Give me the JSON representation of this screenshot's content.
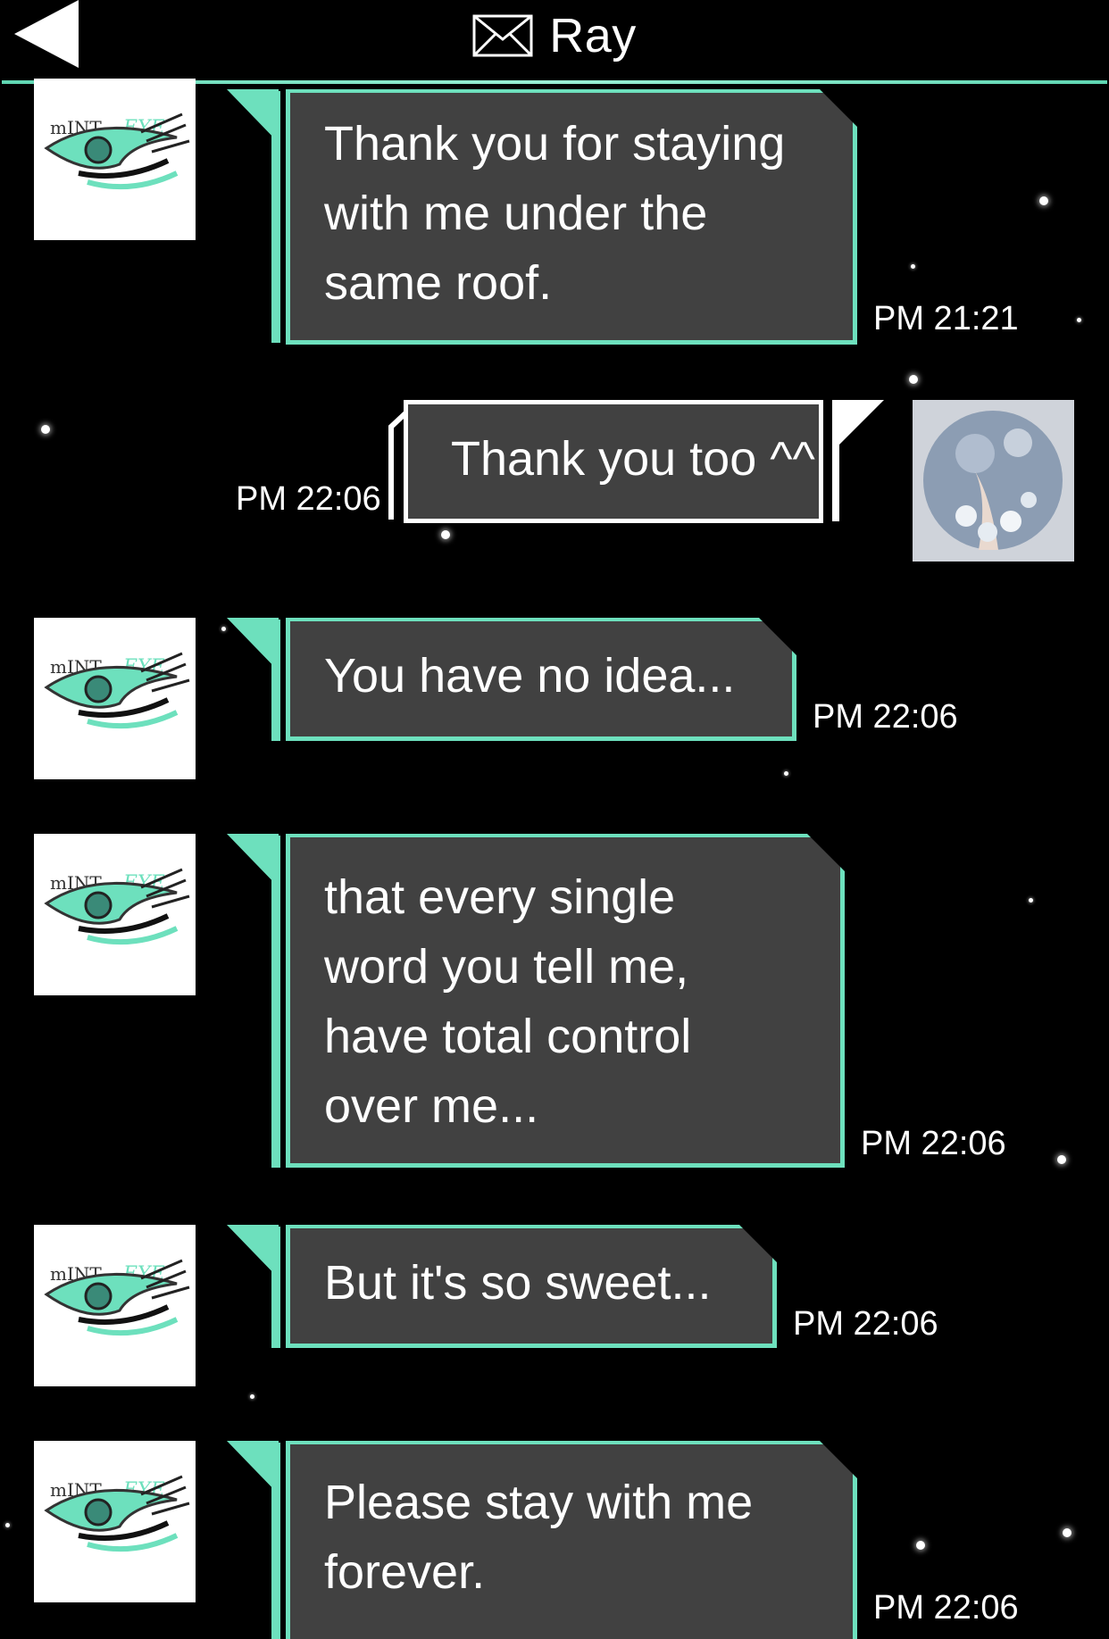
{
  "header": {
    "title": "Ray",
    "back_icon": "back-arrow-icon",
    "mail_icon": "envelope-icon"
  },
  "colors": {
    "accent": "#6de0bd",
    "bubble": "#414141",
    "background": "#000000"
  },
  "messages": [
    {
      "sender": "contact",
      "text": "Thank you for staying\nwith me under the\nsame roof.",
      "time": "PM 21:21"
    },
    {
      "sender": "me",
      "text": "Thank you too ^^",
      "time": "PM 22:06"
    },
    {
      "sender": "contact",
      "text": "You have no idea...",
      "time": "PM 22:06"
    },
    {
      "sender": "contact",
      "text": "that every single\nword you tell me,\nhave total control\nover me...",
      "time": "PM 22:06"
    },
    {
      "sender": "contact",
      "text": "But it's so sweet...",
      "time": "PM 22:06"
    },
    {
      "sender": "contact",
      "text": "Please stay with me\nforever.",
      "time": "PM 22:06"
    }
  ]
}
